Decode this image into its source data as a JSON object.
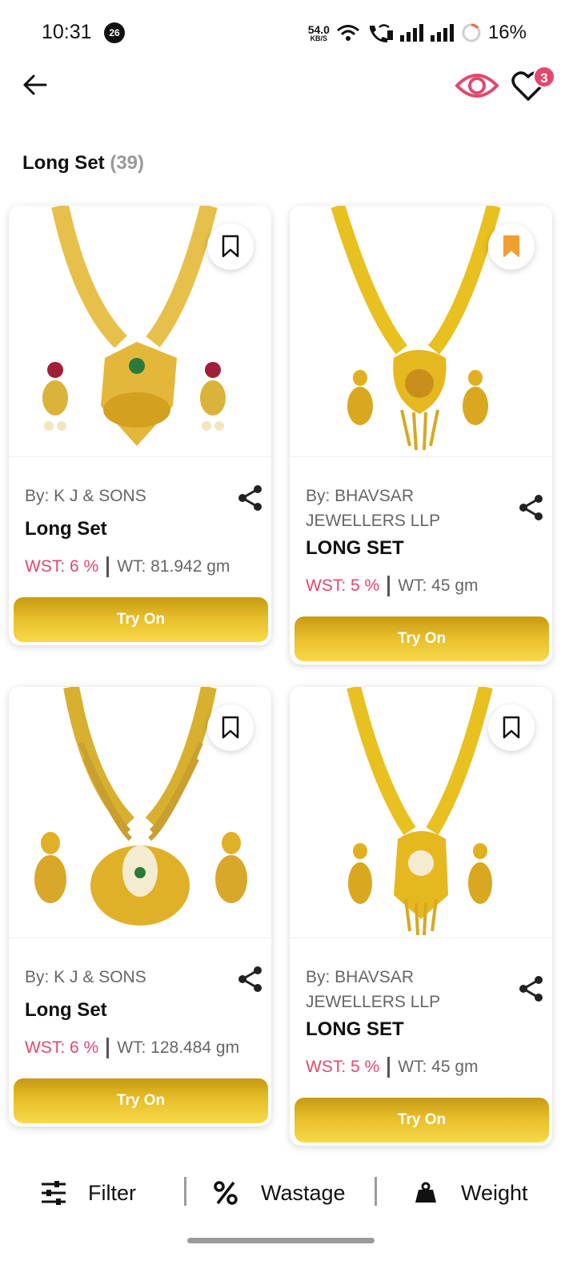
{
  "status_bar": {
    "time": "10:31",
    "notification_count": "26",
    "net_speed_value": "54.0",
    "net_speed_unit": "KB/S",
    "battery": "16%"
  },
  "header": {
    "wishlist_count": "3",
    "accent_color": "#e2486e"
  },
  "page": {
    "title": "Long Set",
    "count": "(39)"
  },
  "products": [
    {
      "by": "By: K J & SONS",
      "name": "Long Set",
      "wst": "WST: 6 %",
      "wt": "WT: 81.942 gm",
      "button": "Try On",
      "bookmarked": false,
      "image": "gold-long-necklace-set"
    },
    {
      "by": "By: BHAVSAR JEWELLERS LLP",
      "name": "LONG SET",
      "wst": "WST: 5 %",
      "wt": "WT: 45 gm",
      "button": "Try On",
      "bookmarked": true,
      "image": "gold-long-necklace-set"
    },
    {
      "by": "By: K J & SONS",
      "name": "Long Set",
      "wst": "WST: 6 %",
      "wt": "WT: 128.484 gm",
      "button": "Try On",
      "bookmarked": false,
      "image": "gold-layered-necklace-set"
    },
    {
      "by": "By: BHAVSAR JEWELLERS LLP",
      "name": "LONG SET",
      "wst": "WST: 5 %",
      "wt": "WT: 45 gm",
      "button": "Try On",
      "bookmarked": false,
      "image": "gold-long-necklace-set"
    }
  ],
  "bottom_bar": {
    "filter": "Filter",
    "wastage": "Wastage",
    "weight": "Weight"
  },
  "colors": {
    "bookmark_active": "#f0a030",
    "button_gold": "#e7bd2a"
  }
}
